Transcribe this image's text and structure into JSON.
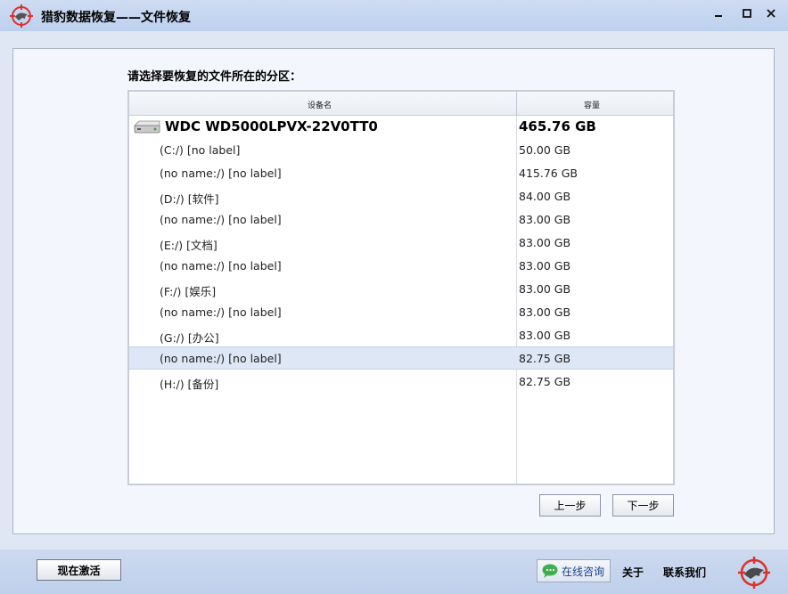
{
  "window": {
    "title": "猎豹数据恢复——文件恢复",
    "controls": {
      "minimize": "_",
      "maximize": "□",
      "close": "✕"
    }
  },
  "main": {
    "prompt": "请选择要恢复的文件所在的分区：",
    "columns": {
      "name": "设备名",
      "capacity": "容量"
    },
    "disk": {
      "name": "WDC WD5000LPVX-22V0TT0",
      "capacity": "465.76 GB",
      "icon": "hard-disk-icon"
    },
    "partitions": [
      {
        "name": "(C:/) [no label]",
        "capacity": "50.00 GB"
      },
      {
        "name": "(no name:/) [no label]",
        "capacity": "415.76 GB"
      },
      {
        "name": "(D:/) [软件]",
        "capacity": "84.00 GB"
      },
      {
        "name": "(no name:/) [no label]",
        "capacity": "83.00 GB"
      },
      {
        "name": "(E:/) [文档]",
        "capacity": "83.00 GB"
      },
      {
        "name": "(no name:/) [no label]",
        "capacity": "83.00 GB"
      },
      {
        "name": "(F:/) [娱乐]",
        "capacity": "83.00 GB"
      },
      {
        "name": "(no name:/) [no label]",
        "capacity": "83.00 GB"
      },
      {
        "name": "(G:/) [办公]",
        "capacity": "83.00 GB"
      },
      {
        "name": "(no name:/) [no label]",
        "capacity": "82.75 GB",
        "selected": true
      },
      {
        "name": "(H:/) [备份]",
        "capacity": "82.75 GB"
      }
    ],
    "buttons": {
      "prev": "上一步",
      "next": "下一步"
    }
  },
  "footer": {
    "activate": "现在激活",
    "consult": "在线咨询",
    "about": "关于",
    "contact": "联系我们"
  },
  "colors": {
    "selection": "#dde7f6",
    "title_bar": "#c4d5f0",
    "logo_red": "#d9322b"
  }
}
